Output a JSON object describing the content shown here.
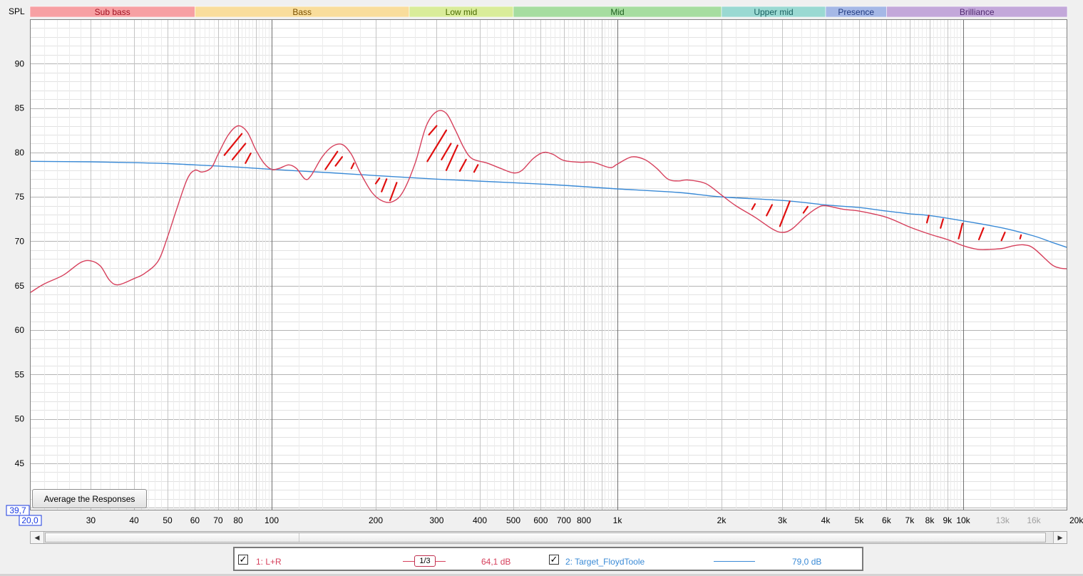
{
  "chart_data": {
    "type": "line",
    "ylabel": "SPL",
    "xunit": "Hz",
    "xscale": "log",
    "xlim": [
      20,
      20000
    ],
    "ylim": [
      39.7,
      95
    ],
    "axis_range_labels": {
      "y_min": "39,7",
      "x_min": "20,0"
    },
    "y_ticks": [
      45,
      50,
      55,
      60,
      65,
      70,
      75,
      80,
      85,
      90
    ],
    "x_ticks": [
      {
        "value": 30,
        "label": "30"
      },
      {
        "value": 40,
        "label": "40"
      },
      {
        "value": 50,
        "label": "50"
      },
      {
        "value": 60,
        "label": "60"
      },
      {
        "value": 70,
        "label": "70"
      },
      {
        "value": 80,
        "label": "80"
      },
      {
        "value": 100,
        "label": "100"
      },
      {
        "value": 200,
        "label": "200"
      },
      {
        "value": 300,
        "label": "300"
      },
      {
        "value": 400,
        "label": "400"
      },
      {
        "value": 500,
        "label": "500"
      },
      {
        "value": 600,
        "label": "600"
      },
      {
        "value": 700,
        "label": "700"
      },
      {
        "value": 800,
        "label": "800"
      },
      {
        "value": 1000,
        "label": "1k"
      },
      {
        "value": 2000,
        "label": "2k"
      },
      {
        "value": 3000,
        "label": "3k"
      },
      {
        "value": 4000,
        "label": "4k"
      },
      {
        "value": 5000,
        "label": "5k"
      },
      {
        "value": 6000,
        "label": "6k"
      },
      {
        "value": 7000,
        "label": "7k"
      },
      {
        "value": 8000,
        "label": "8k"
      },
      {
        "value": 9000,
        "label": "9k"
      },
      {
        "value": 10000,
        "label": "10k"
      },
      {
        "value": 13000,
        "label": "13k",
        "muted": true
      },
      {
        "value": 16000,
        "label": "16k",
        "muted": true
      },
      {
        "value": 20000,
        "label": "20kHz"
      }
    ],
    "bands": [
      {
        "name": "Sub bass",
        "from": 20,
        "to": 60,
        "fill": "#f7a0a3",
        "text": "#a01020"
      },
      {
        "name": "Bass",
        "from": 60,
        "to": 250,
        "fill": "#f9dd9c",
        "text": "#7a5000"
      },
      {
        "name": "Low mid",
        "from": 250,
        "to": 500,
        "fill": "#d9ec9a",
        "text": "#4a6a00"
      },
      {
        "name": "Mid",
        "from": 500,
        "to": 2000,
        "fill": "#a6dda0",
        "text": "#206020"
      },
      {
        "name": "Upper mid",
        "from": 2000,
        "to": 4000,
        "fill": "#9ad9d2",
        "text": "#1a6060"
      },
      {
        "name": "Presence",
        "from": 4000,
        "to": 6000,
        "fill": "#a5b8e6",
        "text": "#203a80"
      },
      {
        "name": "Brilliance",
        "from": 6000,
        "to": 20000,
        "fill": "#c3a8da",
        "text": "#502a70"
      }
    ],
    "series": [
      {
        "name": "1: L+R",
        "color": "#d6405c",
        "points": [
          [
            20,
            64.2
          ],
          [
            22,
            65.2
          ],
          [
            25,
            66.2
          ],
          [
            28,
            67.6
          ],
          [
            30,
            67.8
          ],
          [
            32,
            67.2
          ],
          [
            34,
            65.6
          ],
          [
            36,
            65.1
          ],
          [
            40,
            65.8
          ],
          [
            43,
            66.4
          ],
          [
            47,
            67.8
          ],
          [
            50,
            70.5
          ],
          [
            53,
            73.5
          ],
          [
            57,
            77.0
          ],
          [
            60,
            78.0
          ],
          [
            63,
            77.8
          ],
          [
            67,
            78.3
          ],
          [
            70,
            79.8
          ],
          [
            75,
            82.0
          ],
          [
            80,
            83.0
          ],
          [
            85,
            82.3
          ],
          [
            90,
            80.3
          ],
          [
            95,
            78.8
          ],
          [
            100,
            78.1
          ],
          [
            105,
            78.2
          ],
          [
            112,
            78.6
          ],
          [
            118,
            78.2
          ],
          [
            125,
            77.0
          ],
          [
            130,
            77.4
          ],
          [
            140,
            79.5
          ],
          [
            150,
            80.7
          ],
          [
            160,
            80.9
          ],
          [
            170,
            79.8
          ],
          [
            180,
            77.8
          ],
          [
            195,
            75.5
          ],
          [
            210,
            74.5
          ],
          [
            225,
            74.5
          ],
          [
            240,
            75.6
          ],
          [
            260,
            78.8
          ],
          [
            280,
            83.0
          ],
          [
            300,
            84.6
          ],
          [
            320,
            84.4
          ],
          [
            340,
            82.5
          ],
          [
            360,
            80.5
          ],
          [
            380,
            79.3
          ],
          [
            420,
            78.8
          ],
          [
            460,
            78.2
          ],
          [
            500,
            77.7
          ],
          [
            530,
            78.0
          ],
          [
            570,
            79.3
          ],
          [
            610,
            80.0
          ],
          [
            650,
            79.8
          ],
          [
            700,
            79.1
          ],
          [
            780,
            78.9
          ],
          [
            850,
            78.9
          ],
          [
            950,
            78.3
          ],
          [
            1000,
            78.7
          ],
          [
            1100,
            79.5
          ],
          [
            1200,
            79.2
          ],
          [
            1300,
            78.2
          ],
          [
            1400,
            77.0
          ],
          [
            1500,
            76.8
          ],
          [
            1600,
            76.9
          ],
          [
            1800,
            76.5
          ],
          [
            2000,
            75.2
          ],
          [
            2200,
            74.0
          ],
          [
            2500,
            72.7
          ],
          [
            2800,
            71.4
          ],
          [
            3000,
            71.0
          ],
          [
            3200,
            71.4
          ],
          [
            3500,
            72.8
          ],
          [
            3800,
            73.8
          ],
          [
            4000,
            74.0
          ],
          [
            4500,
            73.6
          ],
          [
            5000,
            73.4
          ],
          [
            6000,
            72.7
          ],
          [
            7000,
            71.6
          ],
          [
            8000,
            70.8
          ],
          [
            9000,
            70.2
          ],
          [
            10000,
            69.5
          ],
          [
            11000,
            69.1
          ],
          [
            12000,
            69.1
          ],
          [
            13000,
            69.2
          ],
          [
            14000,
            69.5
          ],
          [
            15000,
            69.6
          ],
          [
            16000,
            69.2
          ],
          [
            18000,
            67.4
          ],
          [
            19000,
            67.0
          ],
          [
            20000,
            66.9
          ]
        ]
      },
      {
        "name": "2: Target_FloydToole",
        "color": "#3a8ad6",
        "points": [
          [
            20,
            79.0
          ],
          [
            30,
            78.95
          ],
          [
            40,
            78.85
          ],
          [
            50,
            78.75
          ],
          [
            60,
            78.6
          ],
          [
            80,
            78.35
          ],
          [
            100,
            78.1
          ],
          [
            150,
            77.7
          ],
          [
            200,
            77.4
          ],
          [
            300,
            77.0
          ],
          [
            500,
            76.6
          ],
          [
            700,
            76.3
          ],
          [
            1000,
            75.9
          ],
          [
            1500,
            75.5
          ],
          [
            2000,
            75.0
          ],
          [
            3000,
            74.6
          ],
          [
            4000,
            74.1
          ],
          [
            5000,
            73.8
          ],
          [
            6000,
            73.4
          ],
          [
            7000,
            73.1
          ],
          [
            8000,
            72.9
          ],
          [
            10000,
            72.3
          ],
          [
            13000,
            71.5
          ],
          [
            16000,
            70.6
          ],
          [
            18000,
            69.9
          ],
          [
            20000,
            69.3
          ]
        ]
      }
    ],
    "annotations": [
      {
        "f": 73,
        "y": 79.7,
        "f2": 82,
        "y2": 82.1
      },
      {
        "f": 77,
        "y": 79.2,
        "f2": 84,
        "y2": 81.0
      },
      {
        "f": 84,
        "y": 78.8,
        "f2": 87,
        "y2": 79.9
      },
      {
        "f": 143,
        "y": 78.1,
        "f2": 155,
        "y2": 80.1
      },
      {
        "f": 153,
        "y": 78.5,
        "f2": 160,
        "y2": 79.5
      },
      {
        "f": 170,
        "y": 78.2,
        "f2": 173,
        "y2": 78.8
      },
      {
        "f": 200,
        "y": 76.5,
        "f2": 205,
        "y2": 77.1
      },
      {
        "f": 208,
        "y": 75.6,
        "f2": 215,
        "y2": 77.0
      },
      {
        "f": 220,
        "y": 74.6,
        "f2": 230,
        "y2": 76.6
      },
      {
        "f": 285,
        "y": 82.0,
        "f2": 300,
        "y2": 83.0
      },
      {
        "f": 282,
        "y": 79.0,
        "f2": 320,
        "y2": 82.5
      },
      {
        "f": 310,
        "y": 79.2,
        "f2": 330,
        "y2": 81.0
      },
      {
        "f": 320,
        "y": 78.0,
        "f2": 345,
        "y2": 80.8
      },
      {
        "f": 350,
        "y": 77.9,
        "f2": 365,
        "y2": 79.2
      },
      {
        "f": 385,
        "y": 77.8,
        "f2": 395,
        "y2": 78.6
      },
      {
        "f": 2450,
        "y": 73.6,
        "f2": 2500,
        "y2": 74.2
      },
      {
        "f": 2700,
        "y": 72.9,
        "f2": 2800,
        "y2": 74.1
      },
      {
        "f": 2950,
        "y": 71.7,
        "f2": 3150,
        "y2": 74.5
      },
      {
        "f": 3450,
        "y": 73.2,
        "f2": 3550,
        "y2": 73.9
      },
      {
        "f": 7850,
        "y": 72.1,
        "f2": 7950,
        "y2": 72.9
      },
      {
        "f": 8600,
        "y": 71.5,
        "f2": 8750,
        "y2": 72.5
      },
      {
        "f": 9700,
        "y": 70.3,
        "f2": 9950,
        "y2": 72.0
      },
      {
        "f": 11100,
        "y": 70.2,
        "f2": 11450,
        "y2": 71.5
      },
      {
        "f": 12900,
        "y": 70.1,
        "f2": 13200,
        "y2": 71.0
      },
      {
        "f": 14600,
        "y": 70.3,
        "f2": 14700,
        "y2": 70.7
      }
    ]
  },
  "controls": {
    "average_button": "Average the Responses"
  },
  "legend": {
    "series1_label": "1: L+R",
    "series1_smoothing": "1/3",
    "series1_value": "64,1 dB",
    "series2_label": "2: Target_FloydToole",
    "series2_value": "79,0 dB",
    "checkmark": "✓"
  },
  "scrollbar": {
    "left_arrow": "◀",
    "right_arrow": "▶"
  }
}
